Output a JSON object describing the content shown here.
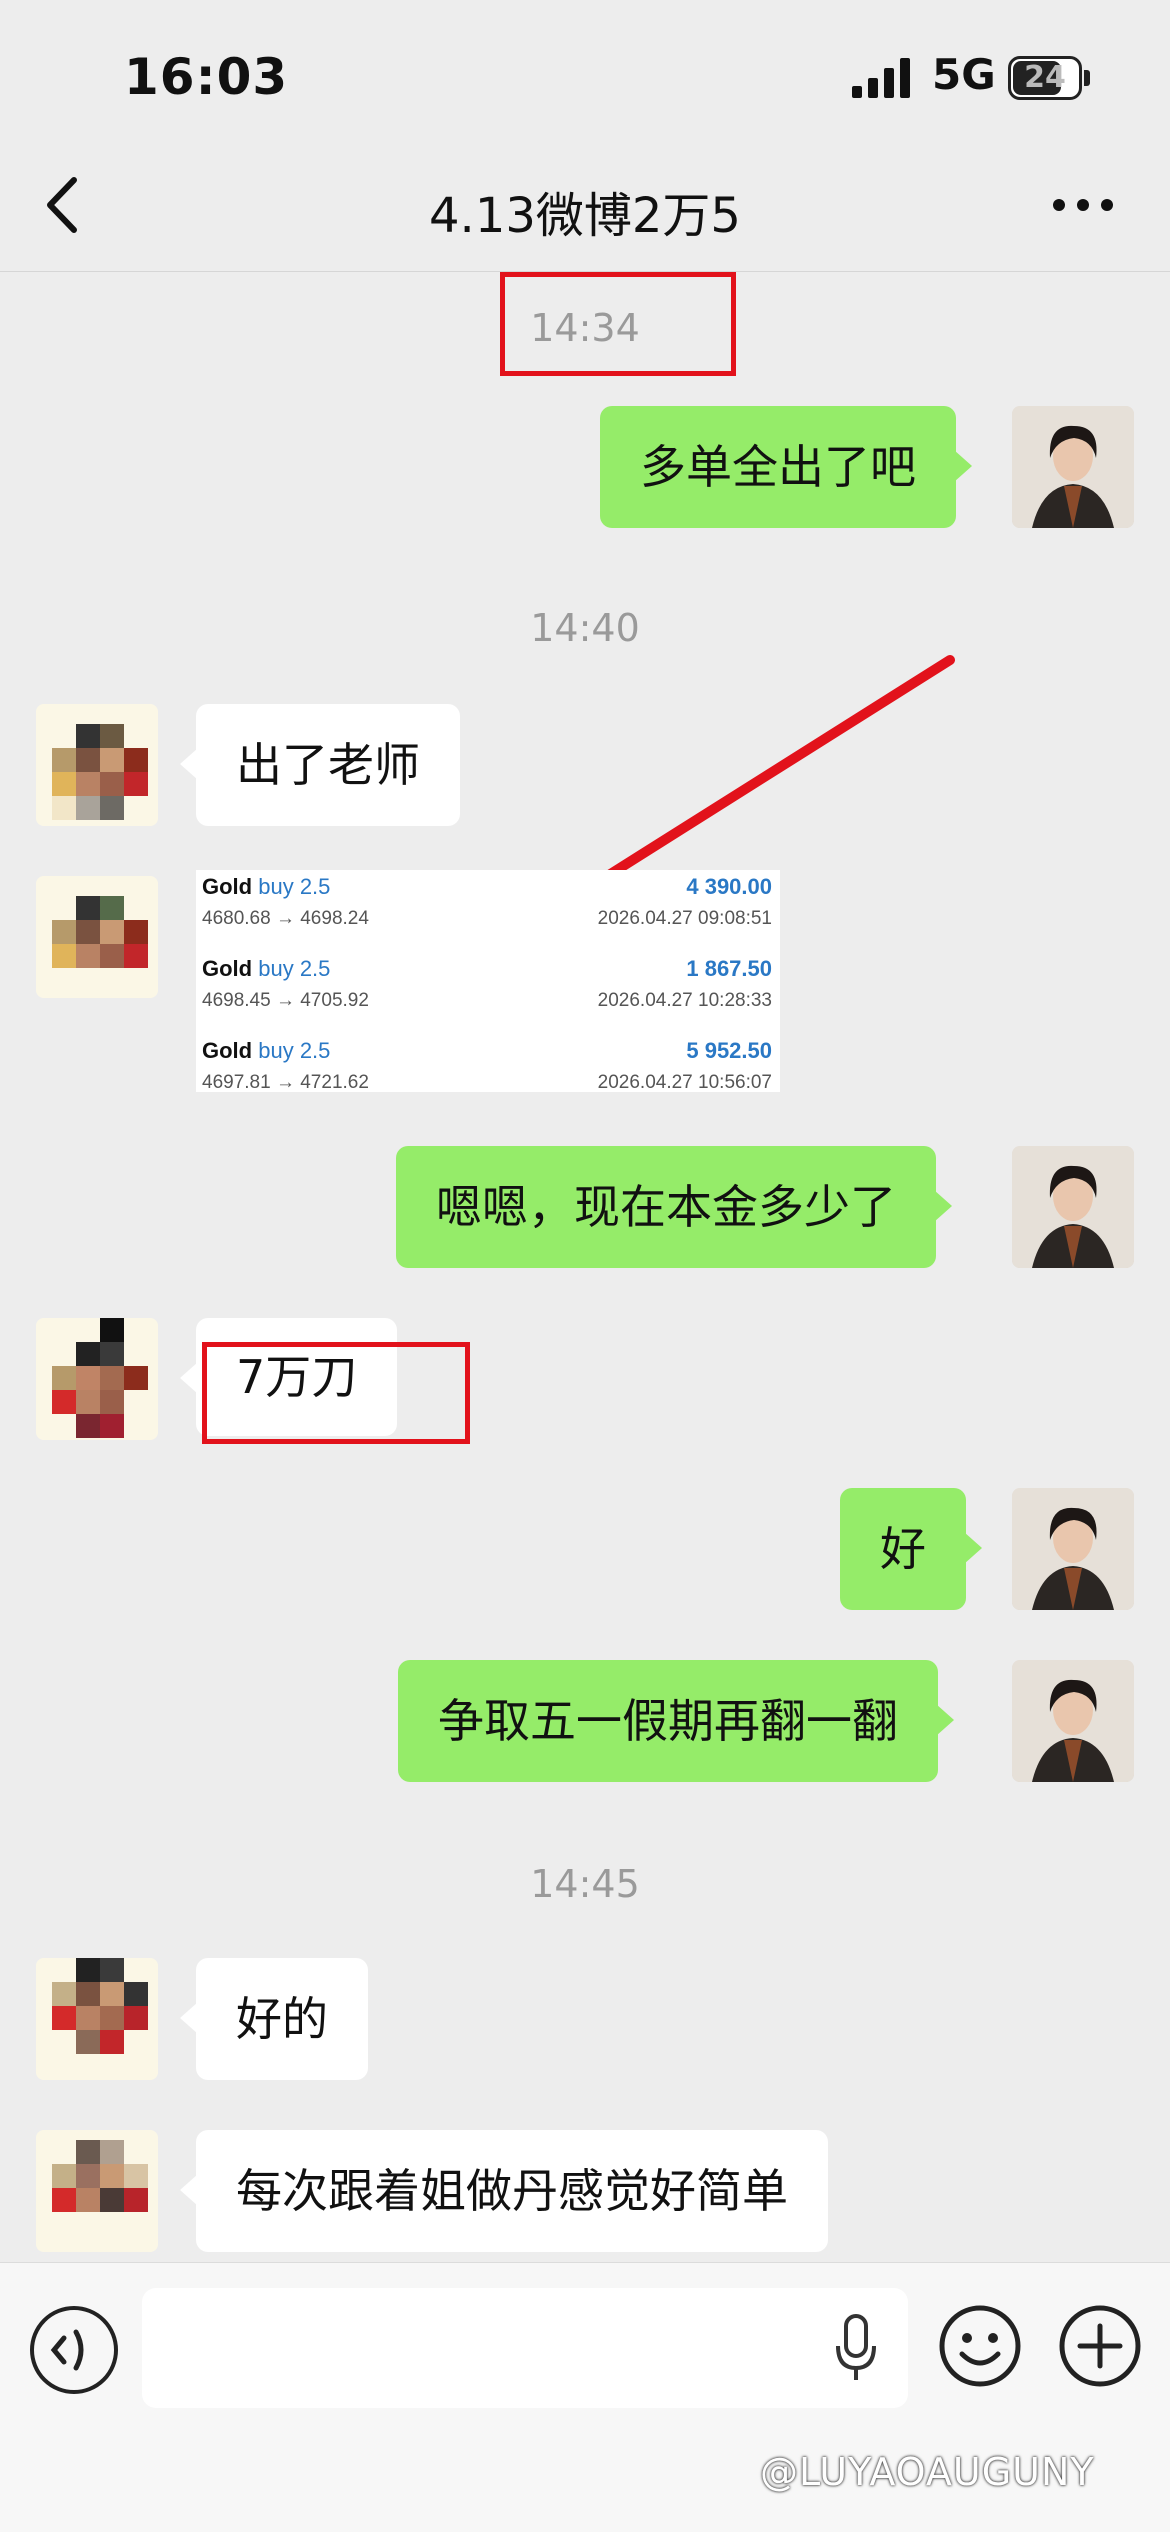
{
  "status_bar": {
    "time": "16:03",
    "network": "5G",
    "battery": "24"
  },
  "header": {
    "title": "4.13微博2万5"
  },
  "timestamps": [
    "14:34",
    "14:40",
    "14:45"
  ],
  "messages": [
    {
      "text": "多单全出了吧"
    },
    {
      "text": "出了老师"
    },
    {
      "text": "嗯嗯，现在本金多少了"
    },
    {
      "text": "7万刀"
    },
    {
      "text": "好"
    },
    {
      "text": "争取五一假期再翻一翻"
    },
    {
      "text": "好的"
    },
    {
      "text": "每次跟着姐做丹感觉好简单"
    }
  ],
  "trades": [
    {
      "symbol": "Gold",
      "side": "buy 2.5",
      "prices": "4680.68 → 4698.24",
      "profit": "4 390.00",
      "date": "2026.04.27 09:08:51"
    },
    {
      "symbol": "Gold",
      "side": "buy 2.5",
      "prices": "4698.45 → 4705.92",
      "profit": "1 867.50",
      "date": "2026.04.27 10:28:33"
    },
    {
      "symbol": "Gold",
      "side": "buy 2.5",
      "prices": "4697.81 → 4721.62",
      "profit": "5 952.50",
      "date": "2026.04.27 10:56:07"
    }
  ],
  "input": {
    "value": ""
  },
  "watermark": "@LUYAOAUGUNY",
  "colors": {
    "my_bubble": "#95ec69",
    "highlight": "#e2121b",
    "profit": "#2a78c5"
  }
}
